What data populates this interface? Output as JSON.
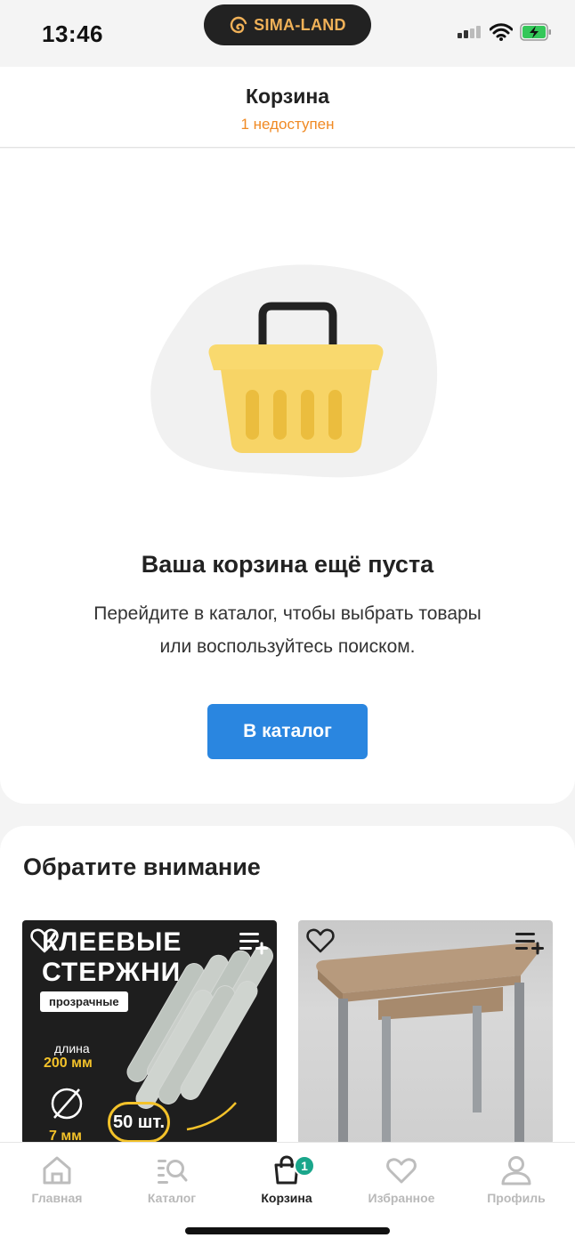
{
  "status_bar": {
    "time": "13:46",
    "island_brand": "SIMA-LAND"
  },
  "header": {
    "title": "Корзина",
    "subtitle": "1 недоступен"
  },
  "empty_state": {
    "title": "Ваша корзина ещё пуста",
    "description_line1": "Перейдите в каталог, чтобы выбрать товары",
    "description_line2": "или воспользуйтесь поиском.",
    "button_label": "В каталог"
  },
  "recommendations": {
    "title": "Обратите внимание",
    "products": [
      {
        "line1": "КЛЕЕВЫЕ",
        "line2": "СТЕРЖНИ",
        "tag": "прозрачные",
        "length_label": "длина",
        "length_value": "200 мм",
        "diameter_value": "7 мм",
        "count": "50 шт."
      },
      {
        "image": "table"
      }
    ]
  },
  "tabbar": {
    "items": [
      {
        "label": "Главная",
        "icon": "home-icon"
      },
      {
        "label": "Каталог",
        "icon": "catalog-search-icon"
      },
      {
        "label": "Корзина",
        "icon": "cart-bag-icon",
        "badge": "1"
      },
      {
        "label": "Избранное",
        "icon": "heart-icon"
      },
      {
        "label": "Профиль",
        "icon": "person-icon"
      }
    ]
  },
  "colors": {
    "accent_blue": "#2a86e0",
    "warning_orange": "#f08a24",
    "badge_green": "#1aa68b",
    "basket_yellow": "#f8d56a"
  }
}
